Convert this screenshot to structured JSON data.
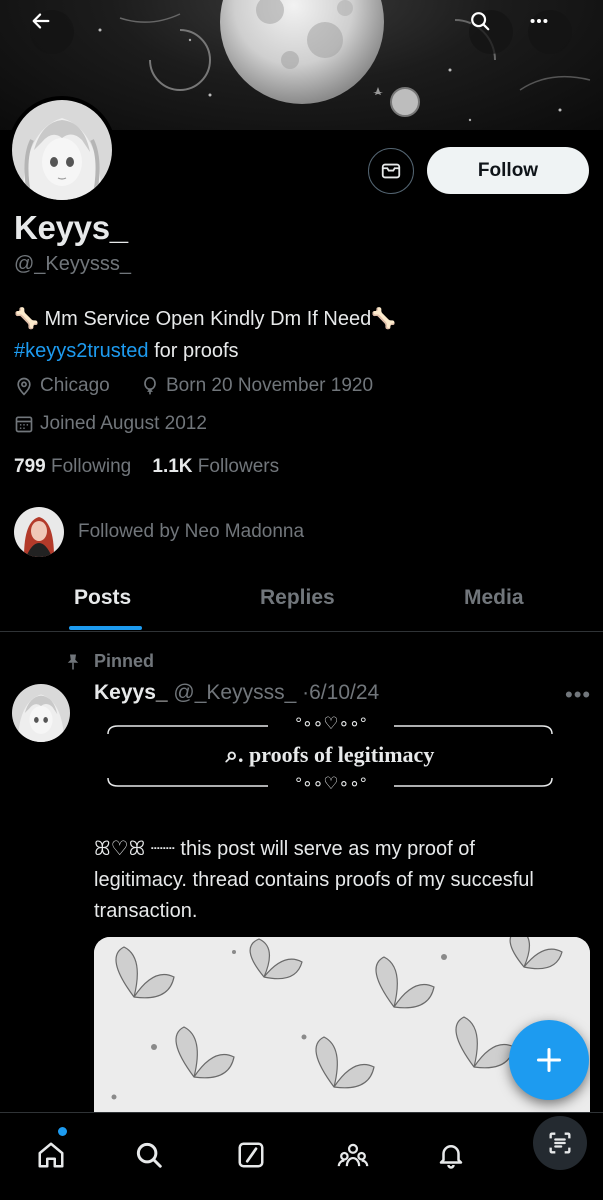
{
  "profile": {
    "display_name": "Keyys_",
    "handle": "@_Keyysss_",
    "follow_label": "Follow",
    "bio_line1": "🦴 Mm Service Open Kindly Dm If Need🦴",
    "bio_hashtag": "#keyys2trusted",
    "bio_line2_rest": " for proofs",
    "location": "Chicago",
    "birthday": "Born 20 November 1920",
    "joined": "Joined August 2012",
    "following_count": "799",
    "following_label": "Following",
    "followers_count": "1.1K",
    "followers_label": "Followers",
    "followed_by": "Followed by Neo Madonna"
  },
  "tabs": [
    {
      "label": "Posts",
      "active": true
    },
    {
      "label": "Replies",
      "active": false
    },
    {
      "label": "Media",
      "active": false
    }
  ],
  "pinned_post": {
    "pinned_label": "Pinned",
    "author_name": "Keyys_",
    "author_handle": "@_Keyysss_",
    "separator": "·",
    "date": "6/10/24",
    "more": "•••",
    "frame_top_decor": "°∘∘♡∘∘°",
    "frame_title": "⌕. proofs of legitimacy",
    "frame_bottom_decor": "°∘∘♡∘∘°",
    "text": "ꕤ♡ꕤ ┈┈ this post will serve as my proof of legitimacy. thread contains proofs of my succesful transaction."
  },
  "icons": {
    "back": "arrow-left-icon",
    "search": "search-icon",
    "more": "more-icon",
    "message": "envelope-icon",
    "location": "location-pin-icon",
    "birthday": "balloon-icon",
    "joined": "calendar-icon",
    "pin": "pin-icon",
    "compose": "plus-icon",
    "nav": [
      "home-icon",
      "search-icon",
      "grok-icon",
      "communities-icon",
      "bell-icon",
      "scan-icon"
    ]
  },
  "colors": {
    "accent": "#1d9bf0",
    "text": "#e7e9ea",
    "muted": "#71767b",
    "background": "#000000"
  }
}
